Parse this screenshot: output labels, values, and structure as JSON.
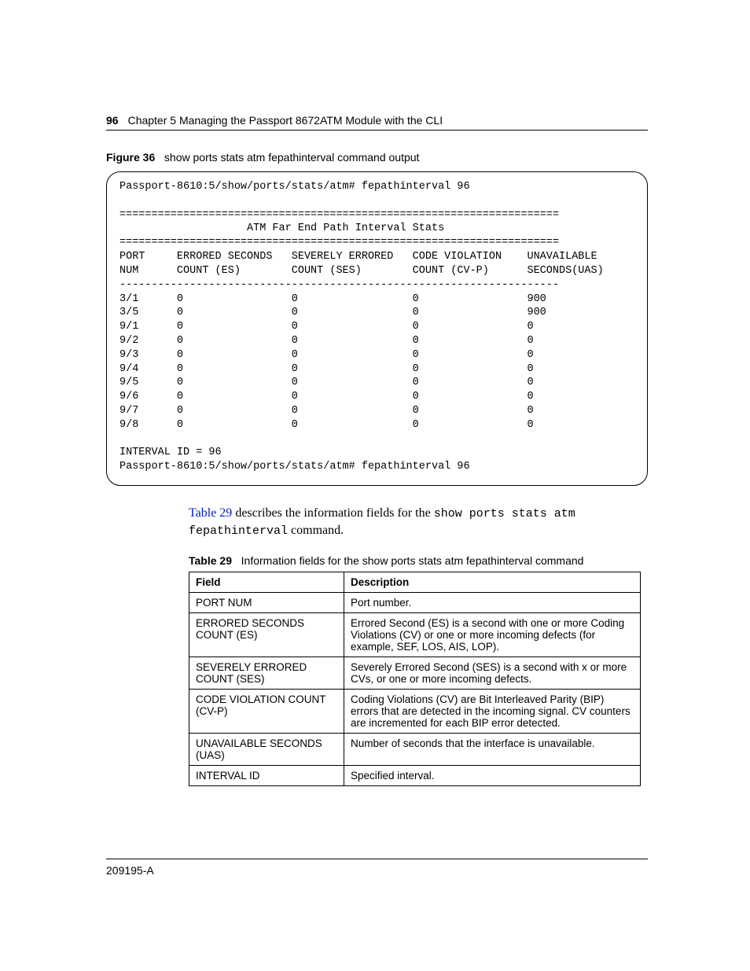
{
  "header": {
    "page_number": "96",
    "chapter_line": "Chapter 5  Managing the Passport 8672ATM Module with the CLI"
  },
  "figure": {
    "label": "Figure 36",
    "title": "show ports stats atm fepathinterval command output"
  },
  "cli": {
    "prompt_line_top": "Passport-8610:5/show/ports/stats/atm# fepathinterval 96",
    "rule_double": "=====================================================================",
    "title_line": "                    ATM Far End Path Interval Stats",
    "hdr1": "PORT     ERRORED SECONDS   SEVERELY ERRORED   CODE VIOLATION    UNAVAILABLE",
    "hdr2": "NUM      COUNT (ES)        COUNT (SES)        COUNT (CV-P)      SECONDS(UAS)",
    "rule_single": "---------------------------------------------------------------------",
    "rows": [
      "3/1      0                 0                  0                 900",
      "3/5      0                 0                  0                 900",
      "9/1      0                 0                  0                 0",
      "9/2      0                 0                  0                 0",
      "9/3      0                 0                  0                 0",
      "9/4      0                 0                  0                 0",
      "9/5      0                 0                  0                 0",
      "9/6      0                 0                  0                 0",
      "9/7      0                 0                  0                 0",
      "9/8      0                 0                  0                 0"
    ],
    "interval_line": "INTERVAL ID = 96",
    "prompt_line_bottom": "Passport-8610:5/show/ports/stats/atm# fepathinterval 96"
  },
  "para": {
    "xref": "Table 29",
    "text_mid": " describes the information fields for the ",
    "code1": "show ports stats atm fepathinterval",
    "text_end": " command."
  },
  "table": {
    "label": "Table 29",
    "title": "Information fields for the show ports stats atm fepathinterval command",
    "head_field": "Field",
    "head_desc": "Description",
    "rows": [
      {
        "field": "PORT NUM",
        "desc": "Port number."
      },
      {
        "field": "ERRORED SECONDS COUNT (ES)",
        "desc": "Errored Second (ES) is a second with one or more Coding Violations (CV) or one or more incoming defects (for example, SEF, LOS, AIS, LOP)."
      },
      {
        "field": "SEVERELY ERRORED COUNT (SES)",
        "desc": "Severely Errored Second (SES) is a second with x or more CVs, or one or more incoming defects."
      },
      {
        "field": "CODE VIOLATION COUNT (CV-P)",
        "desc": "Coding Violations (CV) are Bit Interleaved Parity (BIP) errors that are detected in the incoming signal.  CV counters are incremented for each BIP error detected."
      },
      {
        "field": "UNAVAILABLE SECONDS (UAS)",
        "desc": "Number of seconds that the interface is unavailable."
      },
      {
        "field": "INTERVAL ID",
        "desc": "Specified interval."
      }
    ]
  },
  "footer": {
    "docnum": "209195-A"
  }
}
